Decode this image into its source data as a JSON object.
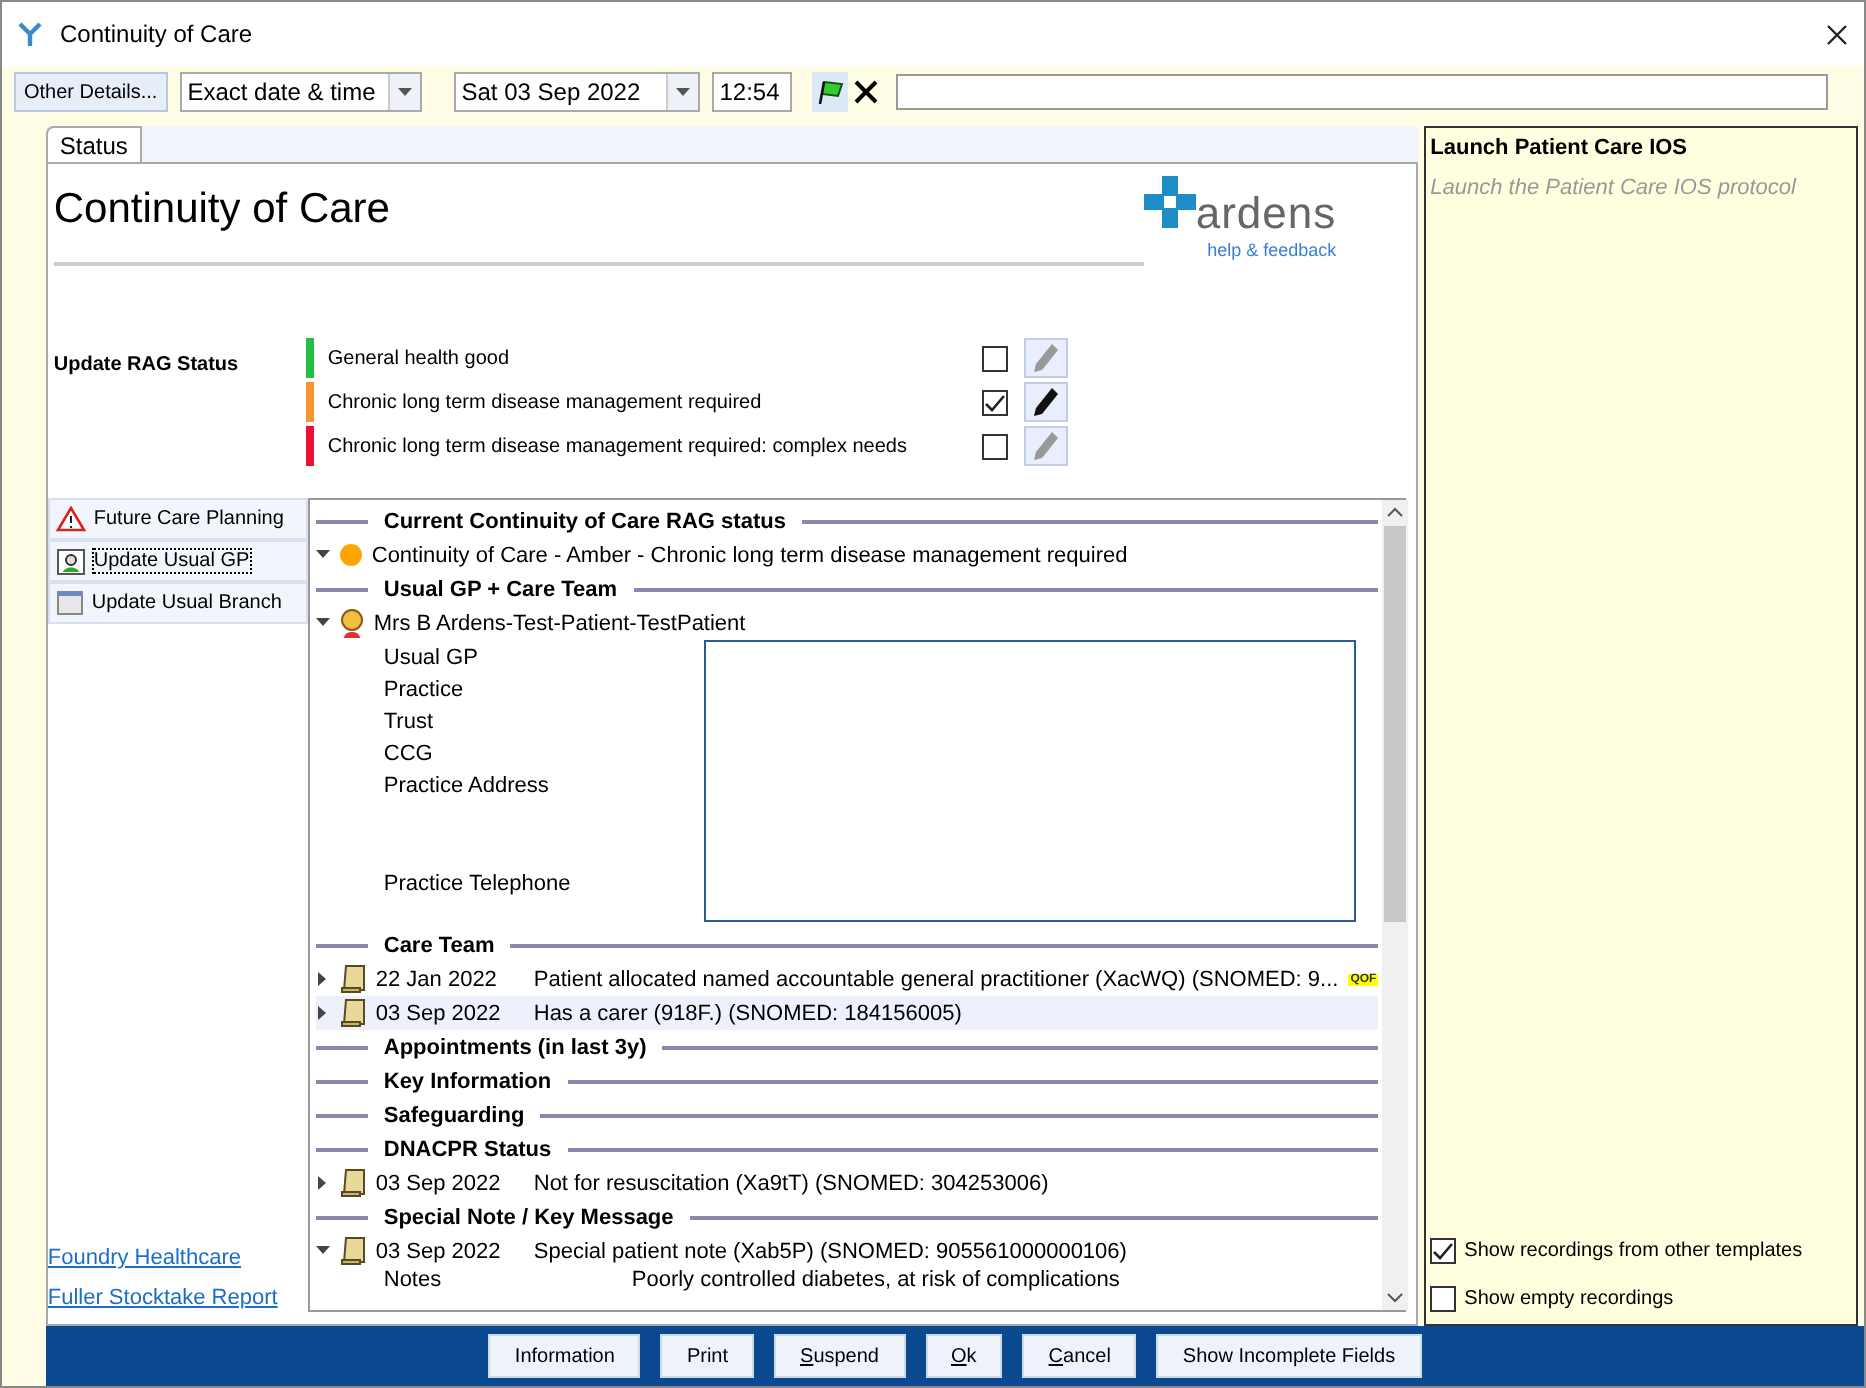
{
  "window": {
    "title": "Continuity of Care"
  },
  "toolbar": {
    "details_button": "Other Details...",
    "date_mode": "Exact date & time",
    "date": "Sat 03 Sep 2022",
    "time": "12:54"
  },
  "tabs": [
    {
      "label": "Status",
      "selected": true
    }
  ],
  "heading": "Continuity of Care",
  "logo": {
    "name": "ardens",
    "link": "help & feedback"
  },
  "rag": {
    "label": "Update RAG Status",
    "options": [
      {
        "label": "General health good",
        "color": "#22c040",
        "checked": false
      },
      {
        "label": "Chronic long term disease management required",
        "color": "#f7962e",
        "checked": true
      },
      {
        "label": "Chronic long term disease management required: complex needs",
        "color": "#ee1133",
        "checked": false
      }
    ]
  },
  "nav": [
    {
      "kind": "warning",
      "label": "Future Care Planning",
      "focused": false
    },
    {
      "kind": "person",
      "label": "Update Usual GP",
      "focused": true
    },
    {
      "kind": "branch",
      "label": "Update Usual Branch",
      "focused": false
    }
  ],
  "links": [
    "Foundry Healthcare",
    "Fuller Stocktake Report"
  ],
  "sections": [
    {
      "title": "Current Continuity of Care RAG status",
      "rows": [
        {
          "kind": "status",
          "expanded": true,
          "color": "#ffa500",
          "text": "Continuity of Care - Amber - Chronic long term disease management required"
        }
      ]
    },
    {
      "title": "Usual GP + Care Team",
      "rows": [
        {
          "kind": "person",
          "expanded": true,
          "text": "Mrs B Ardens-Test-Patient-TestPatient",
          "fields": [
            {
              "label": "Usual GP",
              "kind": "line"
            },
            {
              "label": "Practice",
              "kind": "line"
            },
            {
              "label": "Trust",
              "kind": "line"
            },
            {
              "label": "CCG",
              "kind": "line"
            },
            {
              "label": "Practice Address",
              "kind": "address"
            },
            {
              "label": "Practice Telephone",
              "kind": "line"
            }
          ]
        }
      ]
    },
    {
      "title": "Care Team",
      "rows": [
        {
          "kind": "entry",
          "expanded": false,
          "selected": false,
          "date": "22 Jan 2022",
          "text": "Patient allocated named accountable general practitioner (XacWQ) (SNOMED: 9...",
          "badge": "QOF"
        },
        {
          "kind": "entry",
          "expanded": false,
          "selected": true,
          "date": "03 Sep 2022",
          "text": "Has a carer (918F.) (SNOMED: 184156005)"
        }
      ]
    },
    {
      "title": "Appointments (in last 3y)"
    },
    {
      "title": "Key Information"
    },
    {
      "title": "Safeguarding"
    },
    {
      "title": "DNACPR Status",
      "rows": [
        {
          "kind": "entry",
          "expanded": false,
          "selected": false,
          "date": "03 Sep 2022",
          "text": "Not for resuscitation (Xa9tT) (SNOMED: 304253006)"
        }
      ]
    },
    {
      "title": "Special Note / Key Message",
      "rows": [
        {
          "kind": "entry",
          "expanded": true,
          "selected": false,
          "date": "03 Sep 2022",
          "text": "Special patient note (Xab5P) (SNOMED: 905561000000106)",
          "details": [
            {
              "label": "Notes",
              "value": "Poorly controlled diabetes, at risk of complications"
            }
          ]
        }
      ]
    }
  ],
  "side_panel": {
    "title": "Launch Patient Care IOS",
    "description": "Launch the Patient Care IOS protocol",
    "options": [
      {
        "label": "Show recordings from other templates",
        "checked": true
      },
      {
        "label": "Show empty recordings",
        "checked": false
      }
    ]
  },
  "buttons": [
    {
      "label": "Information",
      "mnemonic": false
    },
    {
      "label": "Print",
      "mnemonic": false
    },
    {
      "label": "Suspend",
      "mnemonic": true
    },
    {
      "label": "Ok",
      "mnemonic": true
    },
    {
      "label": "Cancel",
      "mnemonic": true
    },
    {
      "label": "Show Incomplete Fields",
      "mnemonic": false
    }
  ]
}
